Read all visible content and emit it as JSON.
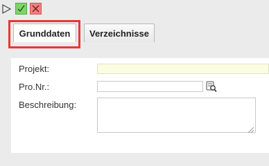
{
  "toolbar": {
    "play_icon": "play-icon",
    "ok_icon": "checkmark-icon",
    "cancel_icon": "close-icon",
    "ok_color": "#7ed36a",
    "cancel_color": "#f08080"
  },
  "tabs": [
    {
      "label": "Grunddaten",
      "active": true
    },
    {
      "label": "Verzeichnisse",
      "active": false
    }
  ],
  "highlight_color": "#e33b2e",
  "form": {
    "projekt": {
      "label": "Projekt:",
      "value": "",
      "background": "#fbfde3"
    },
    "pro_nr": {
      "label": "Pro.Nr.:",
      "value": "",
      "lookup_icon": "lookup-icon"
    },
    "beschreibung": {
      "label": "Beschreibung:",
      "value": ""
    }
  }
}
